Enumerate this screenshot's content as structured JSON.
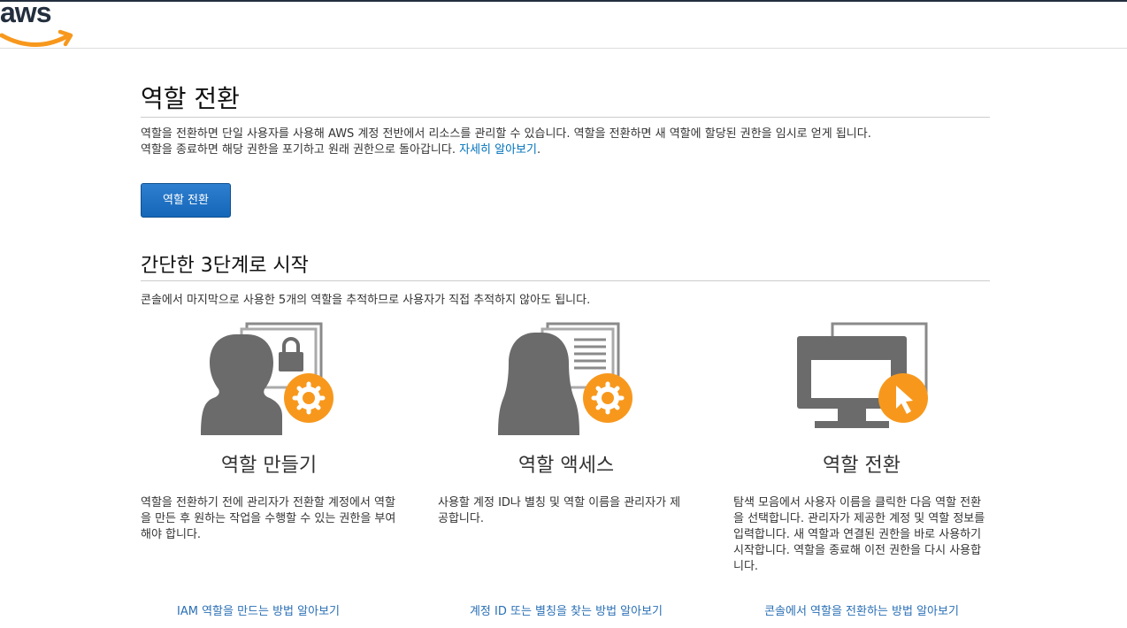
{
  "brand": {
    "logo_text": "aws"
  },
  "page": {
    "title": "역할 전환",
    "description_line1": "역할을 전환하면 단일 사용자를 사용해 AWS 계정 전반에서 리소스를 관리할 수 있습니다. 역할을 전환하면 새 역할에 할당된 권한을 임시로 얻게 됩니다.",
    "description_line2": "역할을 종료하면 해당 권한을 포기하고 원래 권한으로 돌아갑니다.",
    "learn_more": "자세히 알아보기",
    "learn_more_suffix": ".",
    "switch_button": "역할 전환"
  },
  "steps": {
    "title": "간단한 3단계로 시작",
    "subtitle": "콘솔에서 마지막으로 사용한 5개의 역할을 추적하므로 사용자가 직접 추적하지 않아도 됩니다.",
    "cards": [
      {
        "title": "역할 만들기",
        "text": "역할을 전환하기 전에 관리자가 전환할 계정에서 역할을 만든 후 원하는 작업을 수행할 수 있는 권한을 부여해야 합니다.",
        "link": "IAM 역할을 만드는 방법 알아보기",
        "icon": "person-lock-gear-icon"
      },
      {
        "title": "역할 액세스",
        "text": "사용할 계정 ID나 별칭 및 역할 이름을 관리자가 제공합니다.",
        "link": "계정 ID 또는 별칭을 찾는 방법 알아보기",
        "icon": "person-document-gear-icon"
      },
      {
        "title": "역할 전환",
        "text": "탐색 모음에서 사용자 이름을 클릭한 다음 역할 전환을 선택합니다. 관리자가 제공한 계정 및 역할 정보를 입력합니다. 새 역할과 연결된 권한을 바로 사용하기 시작합니다. 역할을 종료해 이전 권한을 다시 사용합니다.",
        "link": "콘솔에서 역할을 전환하는 방법 알아보기",
        "icon": "monitor-cursor-icon"
      }
    ]
  },
  "colors": {
    "accent_orange": "#f7981d",
    "icon_gray": "#6b6b6b",
    "link_blue": "#0073bb",
    "button_blue": "#1f72c4"
  }
}
